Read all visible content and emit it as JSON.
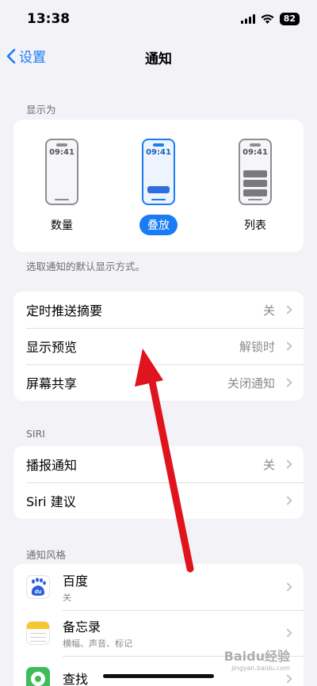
{
  "status_bar": {
    "time": "13:38",
    "battery": "82"
  },
  "nav": {
    "back_label": "设置",
    "title": "通知"
  },
  "display_as": {
    "header": "显示为",
    "options": [
      {
        "label": "数量",
        "phone_time": "09:41",
        "selected": false
      },
      {
        "label": "叠放",
        "phone_time": "09:41",
        "selected": true
      },
      {
        "label": "列表",
        "phone_time": "09:41",
        "selected": false
      }
    ],
    "footnote": "选取通知的默认显示方式。"
  },
  "general": [
    {
      "label": "定时推送摘要",
      "value": "关"
    },
    {
      "label": "显示预览",
      "value": "解锁时"
    },
    {
      "label": "屏幕共享",
      "value": "关闭通知"
    }
  ],
  "siri": {
    "header": "SIRI",
    "items": [
      {
        "label": "播报通知",
        "value": "关"
      },
      {
        "label": "Siri 建议",
        "value": ""
      }
    ]
  },
  "notification_style": {
    "header": "通知风格",
    "apps": [
      {
        "name": "百度",
        "subtitle": "关",
        "icon": "baidu-icon",
        "icon_text": "du"
      },
      {
        "name": "备忘录",
        "subtitle": "横幅、声音、标记",
        "icon": "notes-icon"
      },
      {
        "name": "查找",
        "subtitle": "",
        "icon": "find-my-icon"
      }
    ]
  },
  "watermark": {
    "text": "Baidu经验",
    "sub": "jingyan.baidu.com"
  },
  "colors": {
    "accent": "#1a7cf5",
    "arrow": "#e0141c",
    "background": "#f2f2f7"
  }
}
